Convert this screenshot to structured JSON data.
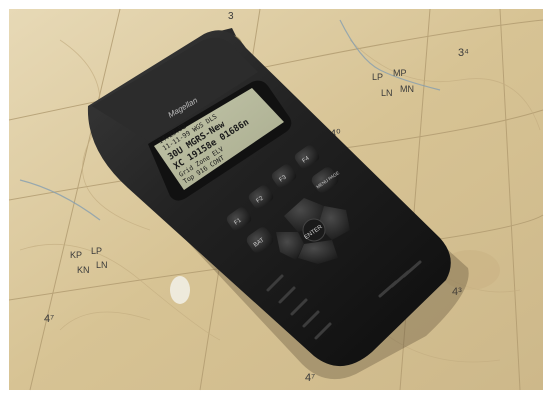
{
  "map": {
    "labels": [
      {
        "text": "3"
      },
      {
        "text": "3⁴"
      },
      {
        "text": "4⁰"
      },
      {
        "text": "4³"
      },
      {
        "text": "4⁷"
      },
      {
        "text": "4⁷"
      },
      {
        "text": "LP"
      },
      {
        "text": "MP"
      },
      {
        "text": "LN"
      },
      {
        "text": "MN"
      },
      {
        "text": "KP"
      },
      {
        "text": "LP"
      },
      {
        "text": "KN"
      },
      {
        "text": "LN"
      }
    ]
  },
  "device": {
    "brand": "Magellan",
    "screen": {
      "lines": [
        "14:23:52",
        "11-11-99  WGS  DLS",
        "30U   MGRS-New",
        "XC 19158e 01686n",
        "Grid Zone  ELV",
        "Top  916   CONT"
      ]
    },
    "keys": {
      "f1": "F1",
      "f2": "F2",
      "f3": "F3",
      "f4": "F4",
      "f5": "F5",
      "f6": "F6",
      "menu": "MENU PAGE",
      "pwr_top": "PWR",
      "pwr_bottom": "BAT",
      "enter": "ENTER"
    }
  },
  "colors": {
    "map_paper": "#d9c79a",
    "map_lines": "#a58f68",
    "device_body": "#1f1f1f",
    "screen_bg": "#b6b99b",
    "screen_text": "#1a1a1a"
  }
}
